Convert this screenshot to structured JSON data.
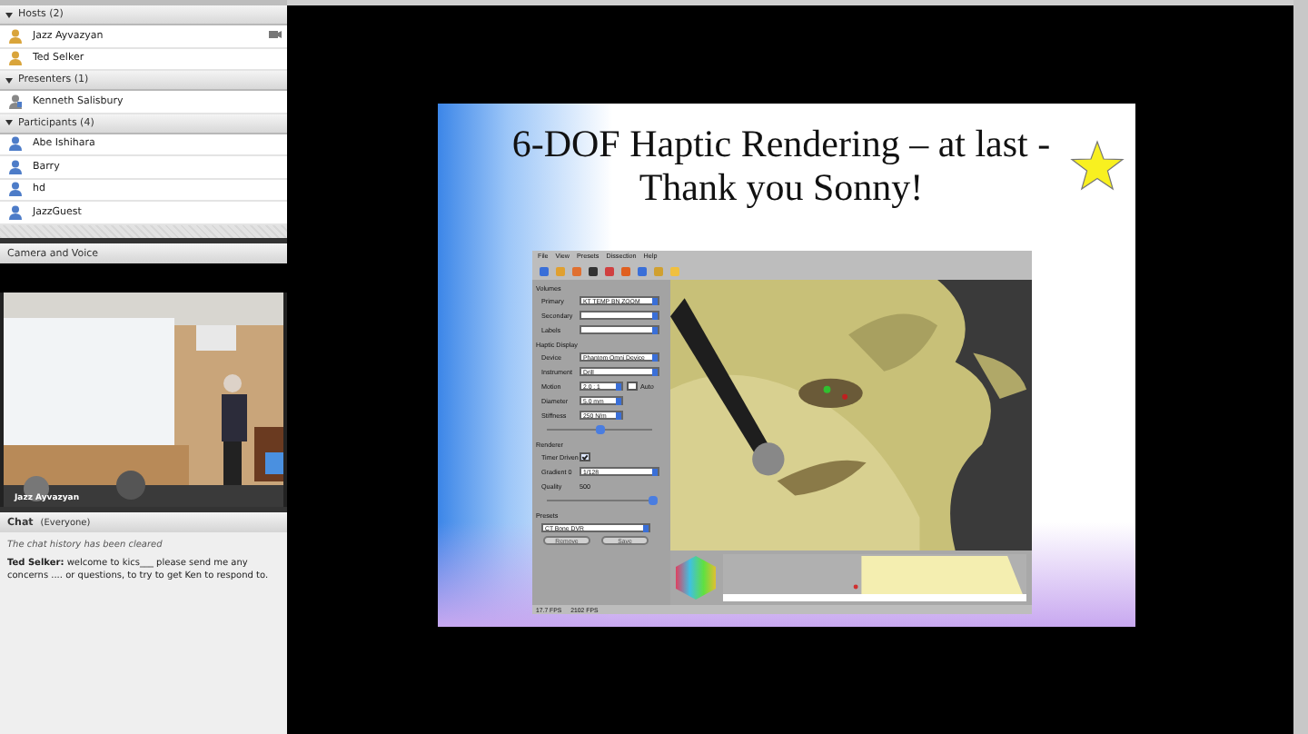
{
  "attendees": [
    {
      "label": "Hosts (2)",
      "expanded": true,
      "members": [
        {
          "name": "Jazz Ayvazyan",
          "kind": "host",
          "webcam": true
        },
        {
          "name": "Ted Selker",
          "kind": "host",
          "webcam": false
        }
      ]
    },
    {
      "label": "Presenters (1)",
      "expanded": true,
      "members": [
        {
          "name": "Kenneth Salisbury",
          "kind": "presenter",
          "webcam": false
        }
      ]
    },
    {
      "label": "Participants (4)",
      "expanded": true,
      "members": [
        {
          "name": "Abe Ishihara",
          "kind": "participant",
          "webcam": false
        },
        {
          "name": "Barry",
          "kind": "participant",
          "webcam": false
        },
        {
          "name": "hd",
          "kind": "participant",
          "webcam": false
        },
        {
          "name": "JazzGuest",
          "kind": "participant",
          "webcam": false
        }
      ]
    }
  ],
  "camera": {
    "title": "Camera and Voice",
    "caption": "Jazz Ayvazyan"
  },
  "chat": {
    "title": "Chat",
    "audience": "(Everyone)",
    "notice": "The chat history has been cleared",
    "messages": [
      {
        "sender": "Ted Selker:",
        "text": "welcome to kics___ please send me any concerns .... or questions, to try to get Ken to respond to."
      }
    ]
  },
  "slide": {
    "title_lines": [
      "6-DOF Haptic Rendering – at last -",
      "Thank you Sonny!"
    ],
    "app": {
      "menu": [
        "File",
        "View",
        "Presets",
        "Dissection",
        "Help"
      ],
      "sections": [
        {
          "title": "Volumes",
          "rows": [
            {
              "kind": "select",
              "label": "Primary",
              "value": "KT TEMP BN ZOOM"
            },
            {
              "kind": "select",
              "label": "Secondary"
            },
            {
              "kind": "select",
              "label": "Labels"
            }
          ]
        },
        {
          "title": "Haptic Display",
          "rows": [
            {
              "kind": "select",
              "label": "Device",
              "value": "Phantom Omni Device"
            },
            {
              "kind": "select",
              "label": "Instrument",
              "value": "Drill"
            },
            {
              "kind": "spin",
              "label": "Motion",
              "value": "2.0 : 1",
              "option": "Auto",
              "checked": false
            },
            {
              "kind": "spin",
              "label": "Diameter",
              "value": "5.0 mm"
            },
            {
              "kind": "spin",
              "label": "Stiffness",
              "value": "250 N/m"
            },
            {
              "kind": "slider",
              "level": 0.5
            }
          ]
        },
        {
          "title": "Renderer",
          "rows": [
            {
              "kind": "check",
              "label": "Timer Driven",
              "checked": true
            },
            {
              "kind": "select",
              "label": "Gradient 0",
              "value": "1/128"
            },
            {
              "kind": "text",
              "label": "Quality",
              "value": "500"
            },
            {
              "kind": "slider",
              "level": 1
            }
          ]
        },
        {
          "title": "Presets",
          "rows": [
            {
              "kind": "select",
              "value": "CT Bone DVR"
            },
            {
              "kind": "buttons",
              "buttons": [
                {
                  "label": "Remove",
                  "disabled": true
                },
                {
                  "label": "Save",
                  "disabled": true
                }
              ]
            }
          ]
        }
      ],
      "status": [
        "17.7 FPS",
        "2102 FPS"
      ]
    }
  }
}
